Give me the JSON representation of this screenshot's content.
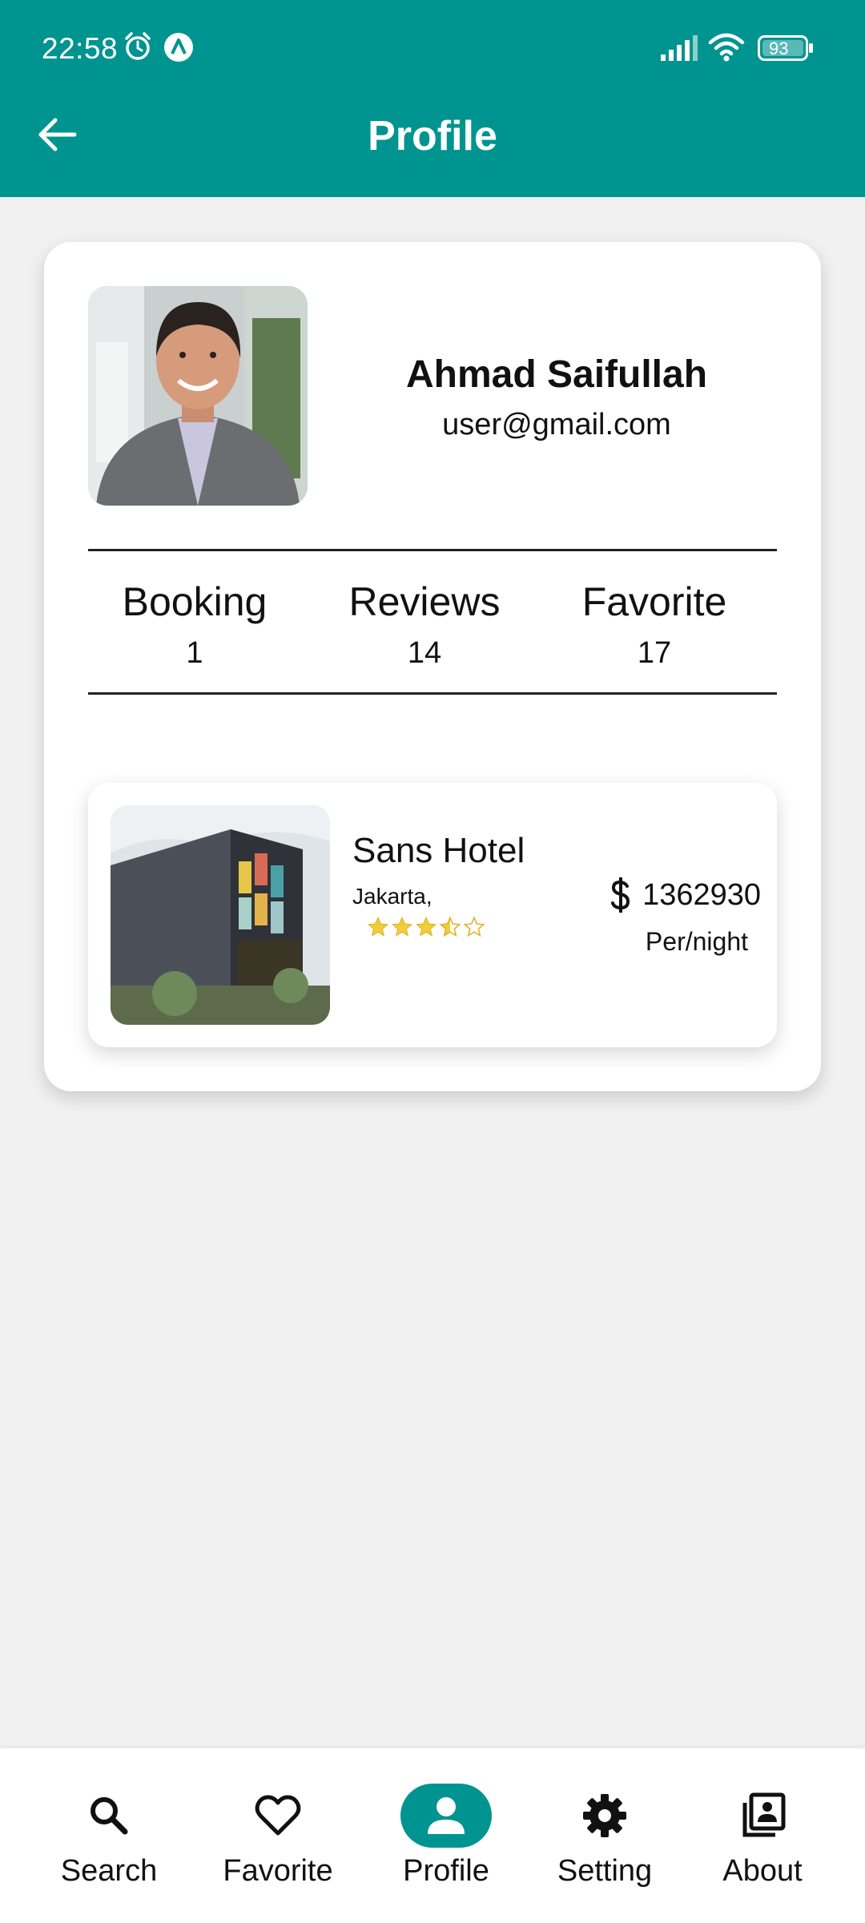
{
  "status_bar": {
    "time": "22:58",
    "battery": "93",
    "icons": [
      "alarm-icon",
      "app-notification-icon",
      "signal-icon",
      "wifi-icon",
      "battery-icon"
    ]
  },
  "app_bar": {
    "title": "Profile",
    "back_icon": "arrow-left-icon",
    "color": "#009490"
  },
  "profile": {
    "name": "Ahmad Saifullah",
    "email": "user@gmail.com",
    "stats": [
      {
        "label": "Booking",
        "value": "1"
      },
      {
        "label": "Reviews",
        "value": "14"
      },
      {
        "label": "Favorite",
        "value": "17"
      }
    ]
  },
  "hotels": [
    {
      "name": "Sans Hotel",
      "city": "Jakarta,",
      "rating": 3.5,
      "rating_max": 5,
      "currency_icon": "dollar-icon",
      "price": "1362930",
      "price_unit": "Per/night"
    }
  ],
  "bottom_nav": {
    "items": [
      {
        "label": "Search",
        "icon": "search-icon"
      },
      {
        "label": "Favorite",
        "icon": "heart-icon"
      },
      {
        "label": "Profile",
        "icon": "person-icon",
        "active": true
      },
      {
        "label": "Setting",
        "icon": "gear-icon"
      },
      {
        "label": "About",
        "icon": "contact-book-icon"
      }
    ],
    "active_color": "#009490"
  },
  "colors": {
    "primary": "#009490",
    "background": "#f1f1f1",
    "star": "#f2cd3a"
  }
}
